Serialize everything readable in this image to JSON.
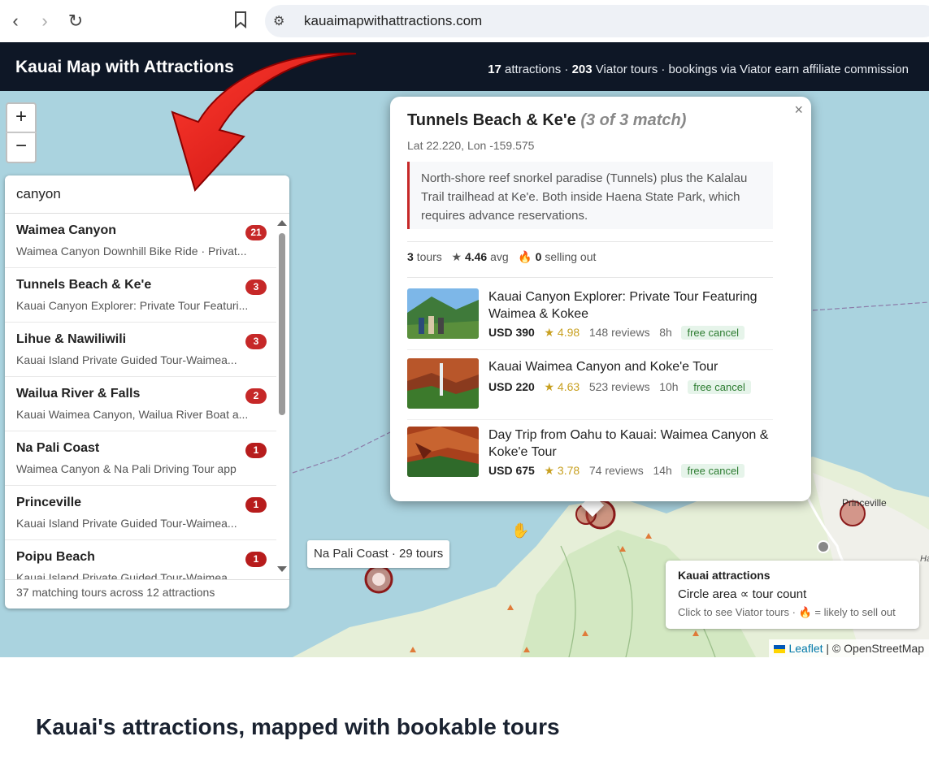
{
  "browser": {
    "url": "kauaimapwithattractions.com",
    "icons": [
      "back-icon",
      "forward-icon",
      "reload-icon",
      "bookmark-icon",
      "site-settings-icon"
    ]
  },
  "header": {
    "title": "Kauai Map with Attractions",
    "attractions_count": "17",
    "attractions_label": "attractions ·",
    "tours_count": "203",
    "tours_label": "Viator tours · bookings via Viator earn affiliate commission"
  },
  "zoom": {
    "in_label": "+",
    "out_label": "−"
  },
  "search": {
    "value": "canyon",
    "results": [
      {
        "name": "Waimea Canyon",
        "count": "21",
        "sub": "Waimea Canyon Downhill Bike Ride · Privat..."
      },
      {
        "name": "Tunnels Beach & Ke'e",
        "count": "3",
        "sub": "Kauai Canyon Explorer: Private Tour Featuri..."
      },
      {
        "name": "Lihue & Nawiliwili",
        "count": "3",
        "sub": "Kauai Island Private Guided Tour-Waimea..."
      },
      {
        "name": "Wailua River & Falls",
        "count": "2",
        "sub": "Kauai Waimea Canyon, Wailua River Boat a..."
      },
      {
        "name": "Na Pali Coast",
        "count": "1",
        "sub": "Waimea Canyon & Na Pali Driving Tour app"
      },
      {
        "name": "Princeville",
        "count": "1",
        "sub": "Kauai Island Private Guided Tour-Waimea..."
      },
      {
        "name": "Poipu Beach",
        "count": "1",
        "sub": "Kauai Island Private Guided Tour-Waimea..."
      }
    ],
    "footer": "37 matching tours across 12 attractions"
  },
  "popup": {
    "close": "×",
    "title": "Tunnels Beach & Ke'e",
    "match": "(3 of 3 match)",
    "coords": "Lat 22.220, Lon -159.575",
    "description": "North-shore reef snorkel paradise (Tunnels) plus the Kalalau Trail trailhead at Ke'e. Both inside Haena State Park, which requires advance reservations.",
    "tours_count": "3",
    "tours_label": "tours",
    "avg_rating": "4.46",
    "avg_label": "avg",
    "selling_out_count": "0",
    "selling_out_label": "selling out",
    "tours": [
      {
        "name": "Kauai Canyon Explorer: Private Tour Featuring Waimea & Kokee",
        "price": "USD 390",
        "rating": "★ 4.98",
        "reviews": "148 reviews",
        "duration": "8h",
        "badge": "free cancel"
      },
      {
        "name": "Kauai Waimea Canyon and Koke'e Tour",
        "price": "USD 220",
        "rating": "★ 4.63",
        "reviews": "523 reviews",
        "duration": "10h",
        "badge": "free cancel"
      },
      {
        "name": "Day Trip from Oahu to Kauai: Waimea Canyon & Koke'e Tour",
        "price": "USD 675",
        "rating": "★ 3.78",
        "reviews": "74 reviews",
        "duration": "14h",
        "badge": "free cancel"
      }
    ]
  },
  "map": {
    "tooltip": "Na Pali Coast · 29 tours",
    "place_label": "Princeville",
    "place_label_partial": "Hanale",
    "legend": {
      "title": "Kauai attractions",
      "line1": "Circle area ∝ tour count",
      "line2": "Click to see Viator tours · 🔥 = likely to sell out"
    },
    "attribution_leaflet": "Leaflet",
    "attribution_osm": "| © OpenStreetMap"
  },
  "page": {
    "section_title": "Kauai's attractions, mapped with bookable tours"
  },
  "colors": {
    "header_bg": "#0e1726",
    "badge_red": "#c62828",
    "marker_red": "#8b1a1a",
    "water": "#aad3df",
    "land": "#e6efd8"
  }
}
